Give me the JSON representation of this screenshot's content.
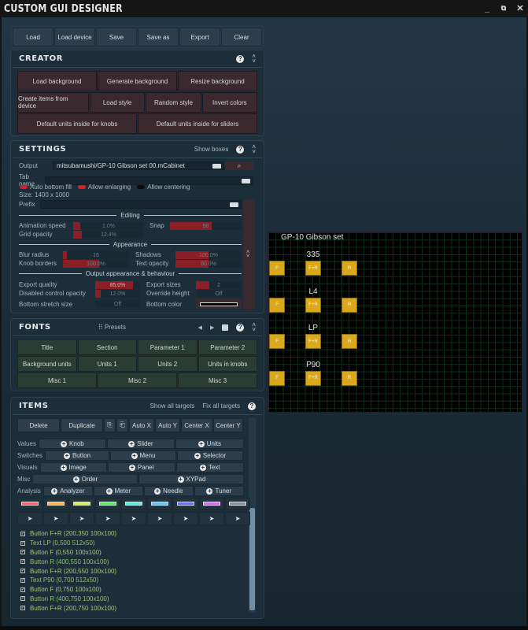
{
  "window": {
    "title": "CUSTOM GUI DESIGNER",
    "controls": [
      "minimize",
      "fullscreen",
      "close"
    ]
  },
  "toolbar": {
    "buttons": [
      "Load",
      "Load device",
      "Save",
      "Save as",
      "Export",
      "Clear"
    ]
  },
  "creator": {
    "title": "CREATOR",
    "rows": [
      [
        "Load background",
        "Generate background",
        "Resize background"
      ],
      [
        "Create items from device",
        "Load style",
        "Random style",
        "Invert colors"
      ],
      [
        "Default units inside for knobs",
        "Default units inside for sliders"
      ]
    ]
  },
  "settings": {
    "title": "SETTINGS",
    "show_boxes": "Show boxes",
    "output_label": "Output",
    "output_value": "mitsubamushi/GP-10 Gibson set 00.mCabinet",
    "tab_name_label": "Tab name",
    "tab_name_value": "",
    "toggles": [
      {
        "label": "Auto bottom fill",
        "on": true
      },
      {
        "label": "Allow enlarging",
        "on": true
      },
      {
        "label": "Allow centering",
        "on": false
      }
    ],
    "size": "Size: 1400 x 1000",
    "prefix_label": "Prefix",
    "editing": {
      "title": "Editing",
      "animation_speed": {
        "label": "Animation speed",
        "value": "1.0%",
        "fraction": 0.1
      },
      "snap": {
        "label": "Snap",
        "value": "50",
        "fraction": 0.58
      },
      "grid_opacity": {
        "label": "Grid opacity",
        "value": "12.4%",
        "fraction": 0.124
      }
    },
    "appearance": {
      "title": "Appearance",
      "blur_radius": {
        "label": "Blur radius",
        "value": "16",
        "fraction": 0.06
      },
      "shadows": {
        "label": "Shadows",
        "value": "100.0%",
        "fraction": 0.5
      },
      "knob_borders": {
        "label": "Knob borders",
        "value": "100.0%",
        "fraction": 0.55
      },
      "text_opacity": {
        "label": "Text opacity",
        "value": "80.0%",
        "fraction": 0.5
      }
    },
    "output_behaviour": {
      "title": "Output appearance & behaviour",
      "export_quality": {
        "label": "Export quality",
        "value": "85.0%",
        "fraction": 0.85
      },
      "export_sizes": {
        "label": "Export sizes",
        "value": "2",
        "fraction": 0.3
      },
      "disabled_opacity": {
        "label": "Disabled control opacity",
        "value": "12.0%",
        "fraction": 0.12
      },
      "override_height": {
        "label": "Override height",
        "value": "Off"
      },
      "bottom_stretch": {
        "label": "Bottom stretch size",
        "value": "Off"
      },
      "bottom_color": {
        "label": "Bottom color",
        "value": "#000000"
      }
    }
  },
  "fonts": {
    "title": "FONTS",
    "presets": "Presets",
    "rows": [
      [
        "Title",
        "Section",
        "Parameter 1",
        "Parameter 2"
      ],
      [
        "Background units",
        "Units 1",
        "Units 2",
        "Units in knobs"
      ],
      [
        "Misc 1",
        "Misc 2",
        "Misc 3"
      ]
    ]
  },
  "items": {
    "title": "ITEMS",
    "show_all_targets": "Show all targets",
    "fix_all_targets": "Fix all targets",
    "actions": [
      "Delete",
      "Duplicate",
      "Auto X",
      "Auto Y",
      "Center X",
      "Center Y"
    ],
    "categories": [
      {
        "label": "Values",
        "items": [
          "Knob",
          "Slider",
          "Units"
        ]
      },
      {
        "label": "Switches",
        "items": [
          "Button",
          "Menu",
          "Selector"
        ]
      },
      {
        "label": "Visuals",
        "items": [
          "Image",
          "Panel",
          "Text"
        ]
      },
      {
        "label": "Misc",
        "items": [
          "Order",
          "XYPad"
        ]
      },
      {
        "label": "Analysis",
        "items": [
          "Analyzer",
          "Meter",
          "Needle",
          "Tuner"
        ]
      }
    ],
    "swatches": [
      "#f06868",
      "#f4b860",
      "#d8ec6a",
      "#6ae06a",
      "#6ae8d8",
      "#6ac0f0",
      "#6a70e8",
      "#d070e8",
      "#909090"
    ],
    "list": [
      "Button F+R (200,350  100x100)",
      "Text LP (0,500  512x50)",
      "Button F (0,550  100x100)",
      "Button R (400,550  100x100)",
      "Button F+R (200,550  100x100)",
      "Text P90 (0,700  512x50)",
      "Button F (0,750  100x100)",
      "Button R (400,750  100x100)",
      "Button F+R (200,750  100x100)"
    ]
  },
  "canvas": {
    "title": "GP-10 Gibson set",
    "groups": [
      {
        "label": "335",
        "buttons": [
          "F",
          "F+R",
          "R"
        ]
      },
      {
        "label": "L4",
        "buttons": [
          "F",
          "F+R",
          "R"
        ]
      },
      {
        "label": "LP",
        "buttons": [
          "F",
          "F+R",
          "R"
        ]
      },
      {
        "label": "P90",
        "buttons": [
          "F",
          "F+R",
          "R"
        ]
      }
    ]
  }
}
